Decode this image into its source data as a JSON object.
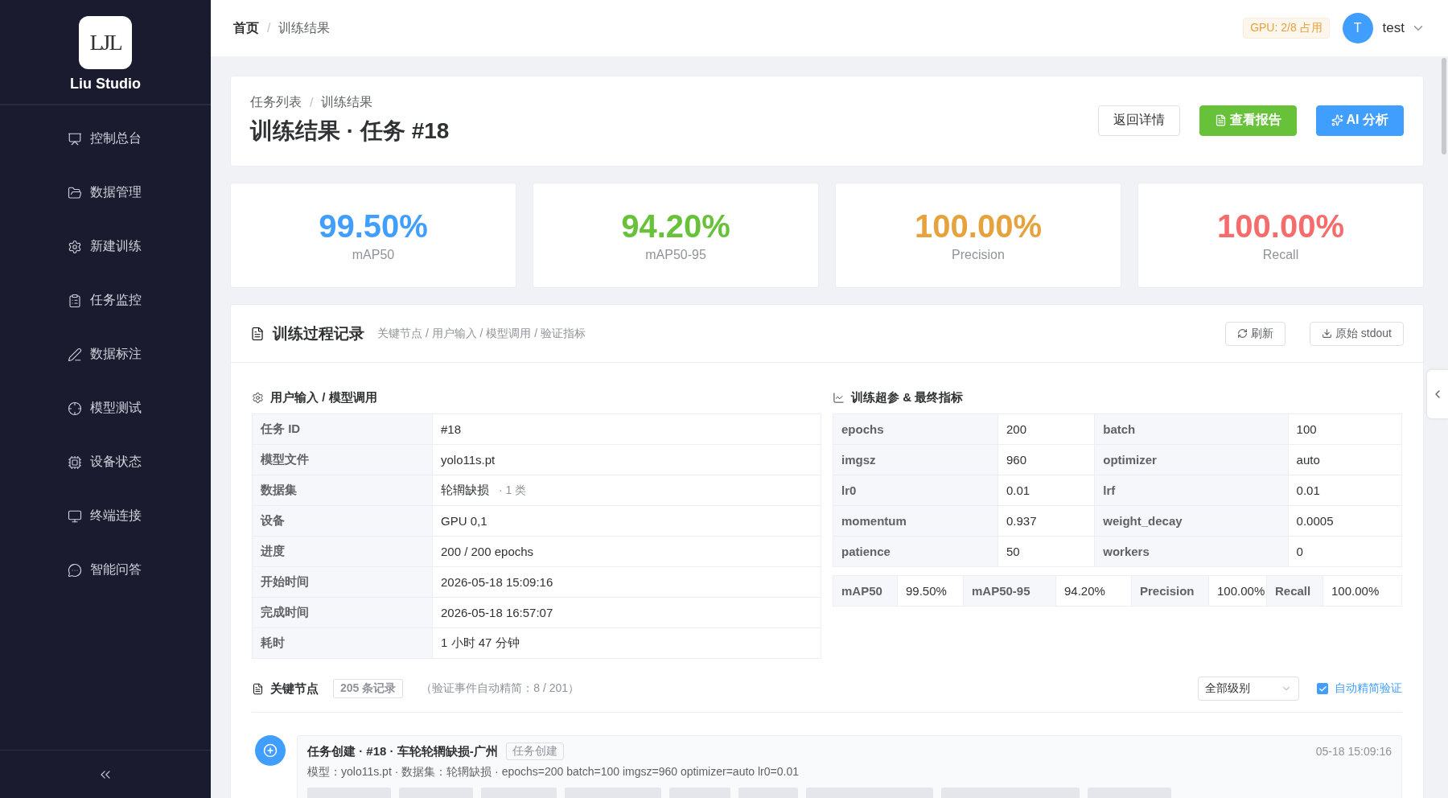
{
  "sidebar": {
    "logo_text": "LJL",
    "brand": "Liu Studio",
    "items": [
      {
        "label": "控制总台"
      },
      {
        "label": "数据管理"
      },
      {
        "label": "新建训练"
      },
      {
        "label": "任务监控"
      },
      {
        "label": "数据标注"
      },
      {
        "label": "模型测试"
      },
      {
        "label": "设备状态"
      },
      {
        "label": "终端连接"
      },
      {
        "label": "智能问答"
      }
    ]
  },
  "header": {
    "breadcrumb": [
      "首页",
      "训练结果"
    ],
    "breadcrumb_separator": "/",
    "gpu_badge": "GPU: 2/8 占用",
    "user": {
      "avatar": "T",
      "name": "test"
    }
  },
  "page_header": {
    "breadcrumb": [
      "任务列表",
      "训练结果"
    ],
    "breadcrumb_separator": "/",
    "title": "训练结果 · 任务 #18",
    "buttons": [
      {
        "label": "返回详情",
        "kind": "default"
      },
      {
        "label": "查看报告",
        "kind": "success"
      },
      {
        "label": "AI 分析",
        "kind": "primary"
      }
    ]
  },
  "stats": [
    {
      "value": "99.50%",
      "label": "mAP50",
      "color": "#409eff"
    },
    {
      "value": "94.20%",
      "label": "mAP50-95",
      "color": "#67c23a"
    },
    {
      "value": "100.00%",
      "label": "Precision",
      "color": "#e6a23c"
    },
    {
      "value": "100.00%",
      "label": "Recall",
      "color": "#f56c6c"
    }
  ],
  "process": {
    "title": "训练过程记录",
    "subtitle": "关键节点 / 用户输入 / 模型调用 / 验证指标",
    "buttons": [
      "刷新",
      "原始 stdout"
    ],
    "inputs": {
      "title": "用户输入 / 模型调用",
      "rows": [
        {
          "label": "任务 ID",
          "value": "#18"
        },
        {
          "label": "模型文件",
          "value": "yolo11s.pt"
        },
        {
          "label": "数据集",
          "value": "轮辋缺损",
          "note": "· 1 类"
        },
        {
          "label": "设备",
          "value": "GPU 0,1"
        },
        {
          "label": "进度",
          "value": "200 / 200 epochs"
        },
        {
          "label": "开始时间",
          "value": "2026-05-18 15:09:16"
        },
        {
          "label": "完成时间",
          "value": "2026-05-18 16:57:07"
        },
        {
          "label": "耗时",
          "value": "1 小时 47 分钟"
        }
      ]
    },
    "params": {
      "title": "训练超参 & 最终指标",
      "rows": [
        [
          {
            "label": "epochs",
            "value": "200"
          },
          {
            "label": "batch",
            "value": "100"
          }
        ],
        [
          {
            "label": "imgsz",
            "value": "960"
          },
          {
            "label": "optimizer",
            "value": "auto"
          }
        ],
        [
          {
            "label": "lr0",
            "value": "0.01"
          },
          {
            "label": "lrf",
            "value": "0.01"
          }
        ],
        [
          {
            "label": "momentum",
            "value": "0.937"
          },
          {
            "label": "weight_decay",
            "value": "0.0005"
          }
        ],
        [
          {
            "label": "patience",
            "value": "50"
          },
          {
            "label": "workers",
            "value": "0"
          }
        ]
      ],
      "metrics": [
        {
          "label": "mAP50",
          "value": "99.50%"
        },
        {
          "label": "mAP50-95",
          "value": "94.20%"
        },
        {
          "label": "Precision",
          "value": "100.00%"
        },
        {
          "label": "Recall",
          "value": "100.00%"
        }
      ]
    },
    "key_nodes": {
      "title": "关键节点",
      "count": "205 条记录",
      "note": "（验证事件自动精简：8 / 201）",
      "filter": "全部级别",
      "auto_trim": {
        "label": "自动精简验证",
        "checked": true
      },
      "events": [
        {
          "title": "任务创建 · #18 · 车轮轮辋缺损-广州",
          "tag": "任务创建",
          "time": "05-18 15:09:16",
          "detail": "模型：yolo11s.pt · 数据集：轮辋缺损 · epochs=200 batch=100 imgsz=960 optimizer=auto lr0=0.01"
        }
      ]
    }
  }
}
